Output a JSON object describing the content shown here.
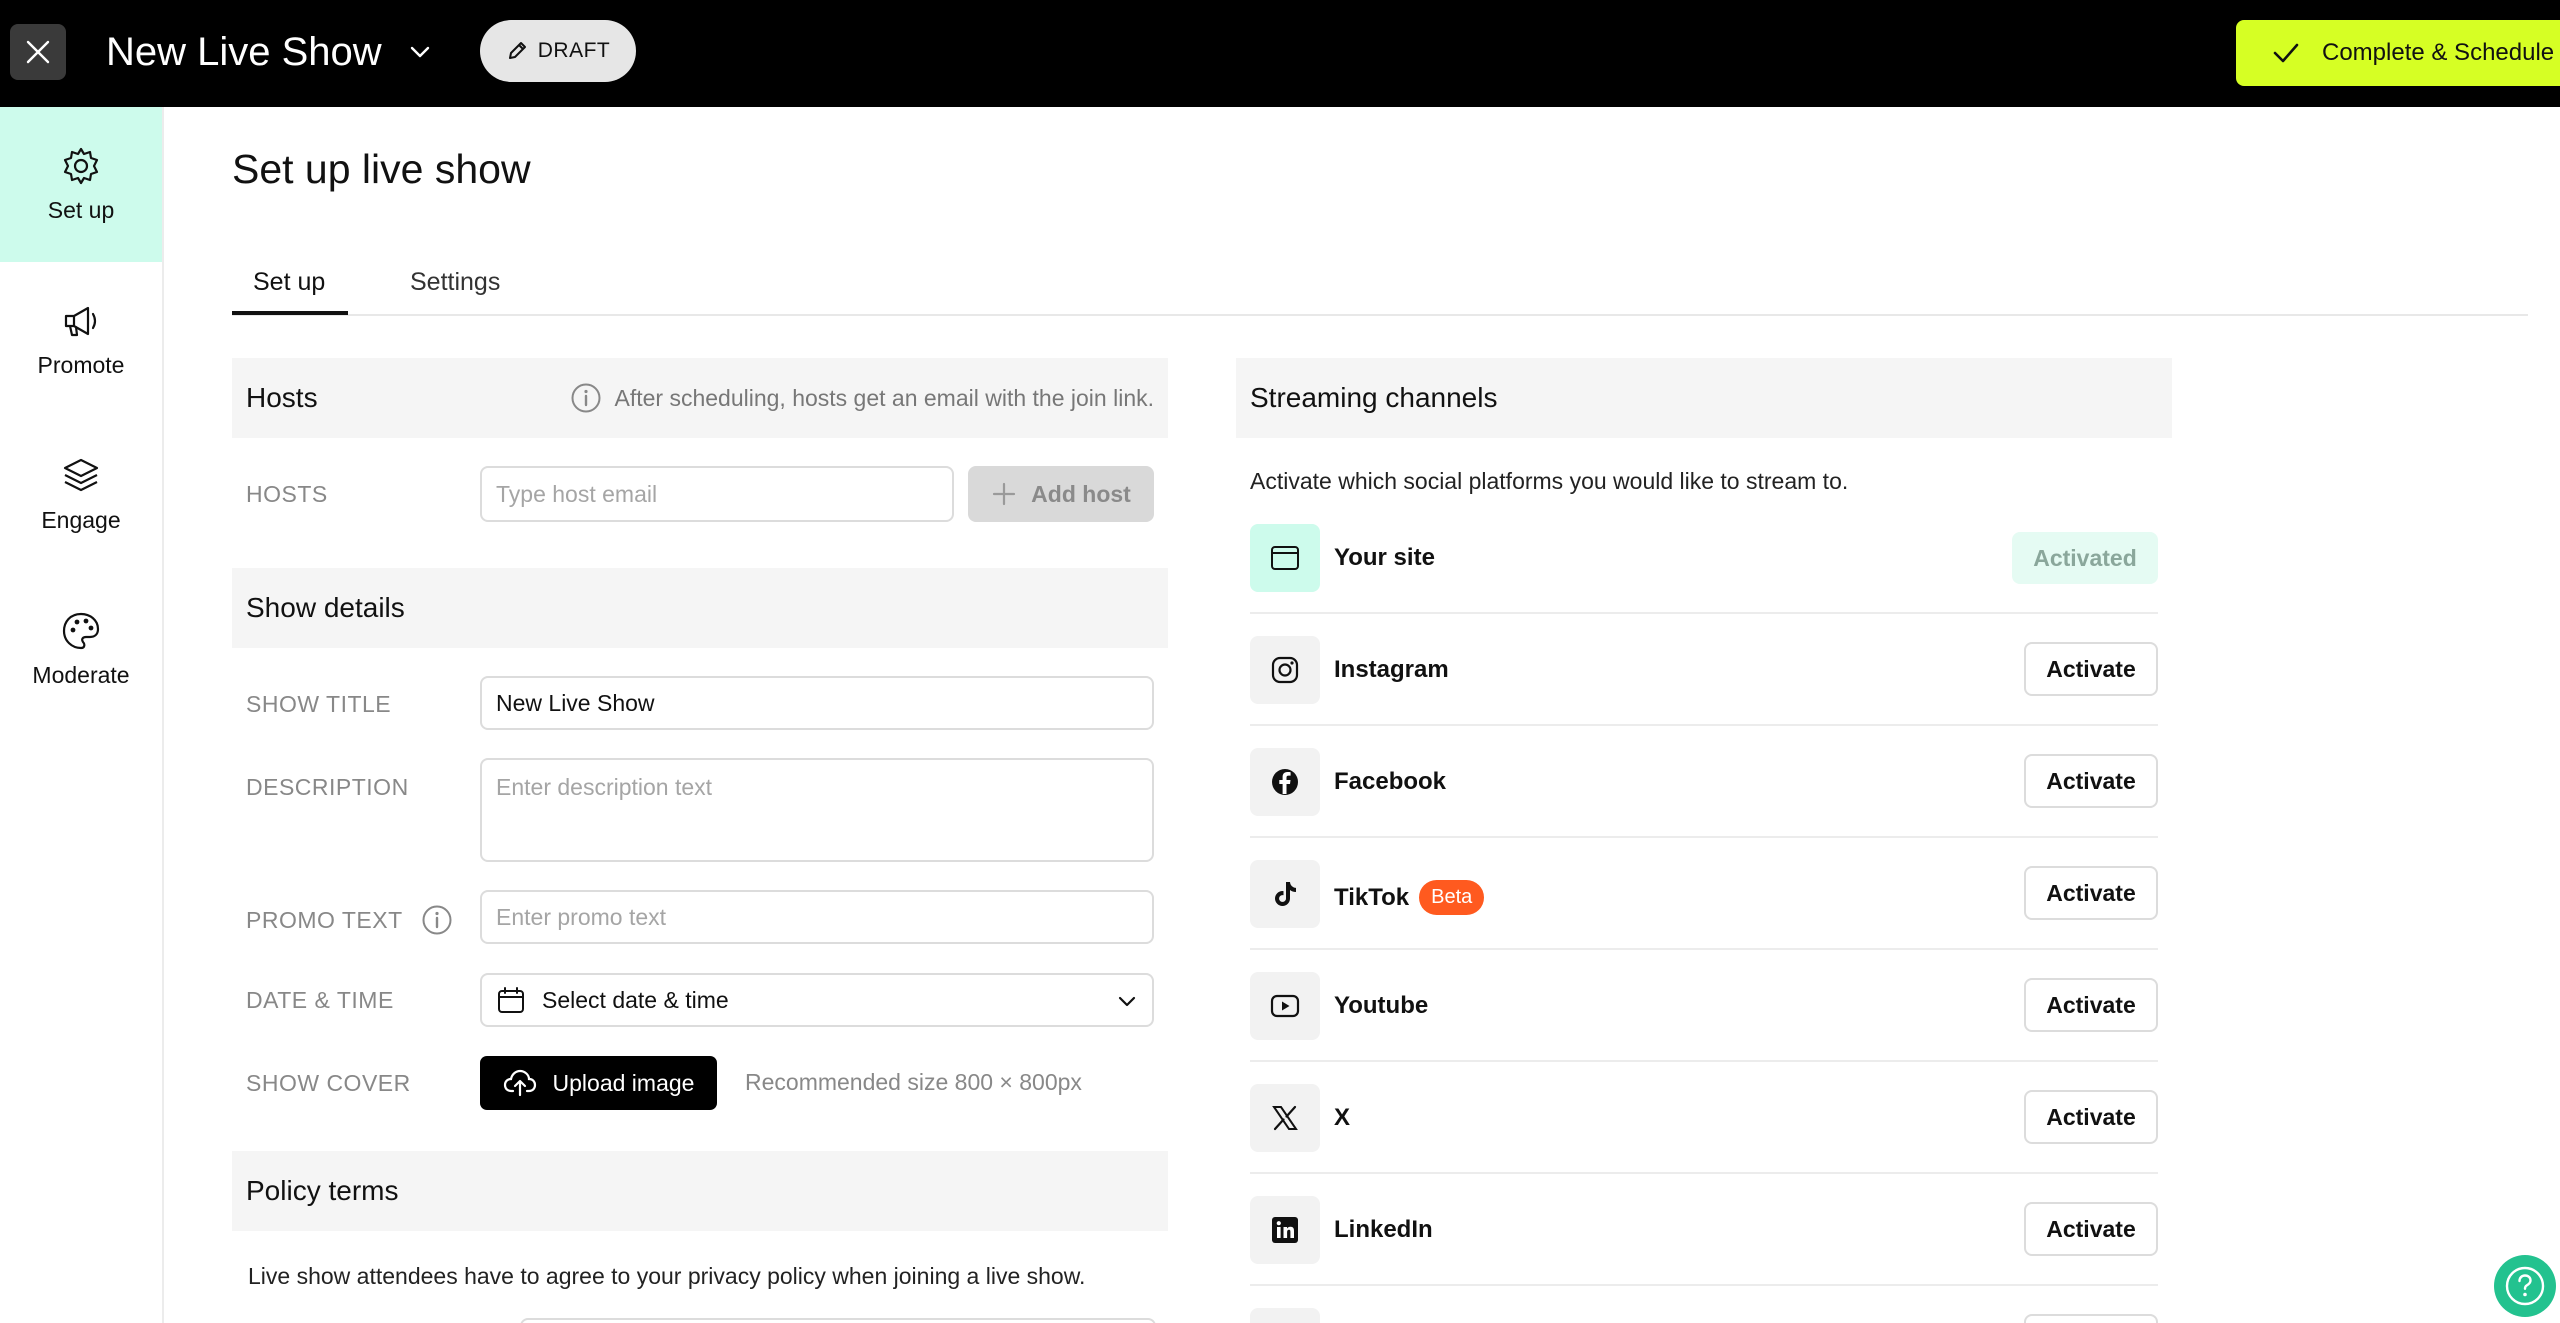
{
  "header": {
    "show_title": "New Live Show",
    "draft_label": "DRAFT",
    "complete_label": "Complete & Schedule",
    "accent_color": "#d6ff24"
  },
  "sidebar": {
    "items": [
      {
        "label": "Set up",
        "icon": "gear-icon",
        "active": true
      },
      {
        "label": "Promote",
        "icon": "megaphone-icon",
        "active": false
      },
      {
        "label": "Engage",
        "icon": "layers-icon",
        "active": false
      },
      {
        "label": "Moderate",
        "icon": "palette-icon",
        "active": false
      }
    ],
    "active_color": "#cdfbec"
  },
  "page": {
    "title": "Set up live show",
    "tabs": [
      {
        "label": "Set up",
        "active": true
      },
      {
        "label": "Settings",
        "active": false
      }
    ]
  },
  "hosts": {
    "title": "Hosts",
    "note": "After scheduling, hosts get an email with the join link.",
    "label": "HOSTS",
    "input_placeholder": "Type host email",
    "add_label": "Add host"
  },
  "show_details": {
    "title": "Show details",
    "title_label": "SHOW TITLE",
    "title_value": "New Live Show",
    "description_label": "DESCRIPTION",
    "description_placeholder": "Enter description text",
    "promo_label": "PROMO TEXT",
    "promo_placeholder": "Enter promo text",
    "date_label": "DATE & TIME",
    "date_value": "Select date & time",
    "cover_label": "SHOW COVER",
    "upload_label": "Upload image",
    "upload_note": "Recommended size 800 × 800px"
  },
  "policy": {
    "title": "Policy terms",
    "text": "Live show attendees have to agree to your privacy policy when joining a live show."
  },
  "streaming": {
    "title": "Streaming channels",
    "subtitle": "Activate which social platforms you would like to stream to.",
    "channels": [
      {
        "name": "Your site",
        "icon": "browser-window-icon",
        "status": "Activated"
      },
      {
        "name": "Instagram",
        "icon": "instagram-icon",
        "status": "Activate"
      },
      {
        "name": "Facebook",
        "icon": "facebook-icon",
        "status": "Activate"
      },
      {
        "name": "TikTok",
        "icon": "tiktok-icon",
        "status": "Activate",
        "badge": "Beta"
      },
      {
        "name": "Youtube",
        "icon": "youtube-icon",
        "status": "Activate"
      },
      {
        "name": "X",
        "icon": "x-icon",
        "status": "Activate"
      },
      {
        "name": "LinkedIn",
        "icon": "linkedin-icon",
        "status": "Activate"
      }
    ],
    "beta_color": "#ff5a1f"
  }
}
